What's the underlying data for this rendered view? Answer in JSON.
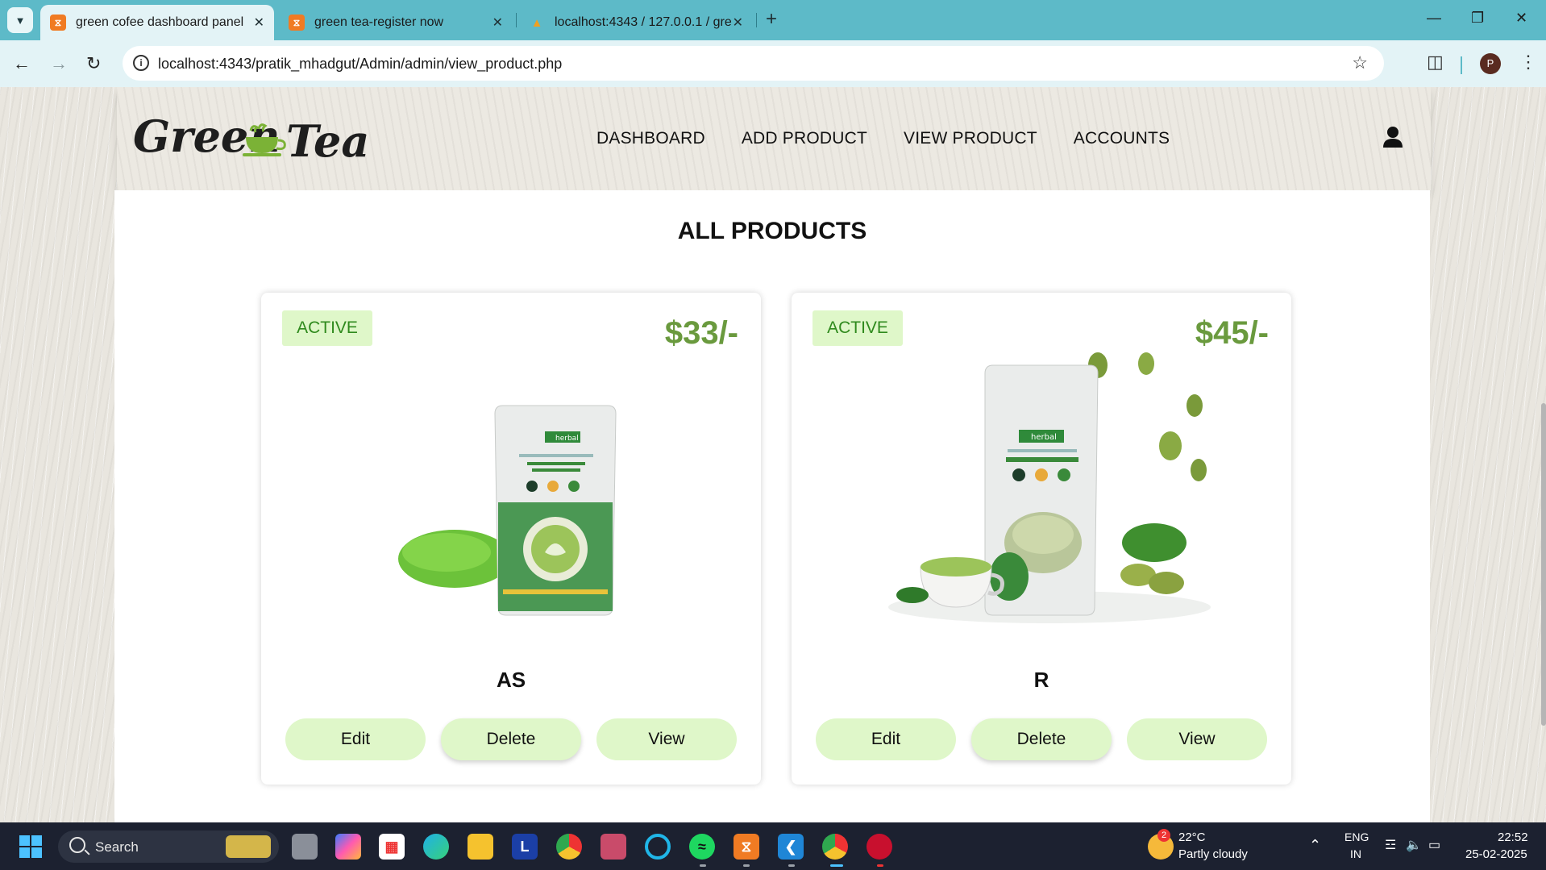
{
  "browser": {
    "tabs": [
      {
        "title": "green cofee dashboard panel",
        "active": true,
        "icon": "xampp-icon"
      },
      {
        "title": "green tea-register now",
        "active": false,
        "icon": "xampp-icon"
      },
      {
        "title": "localhost:4343 / 127.0.0.1 / gre",
        "active": false,
        "icon": "phpmyadmin-icon"
      }
    ],
    "url": "localhost:4343/pratik_mhadgut/Admin/admin/view_product.php",
    "profile_initial": "P"
  },
  "site": {
    "nav": [
      "DASHBOARD",
      "ADD PRODUCT",
      "VIEW PRODUCT",
      "ACCOUNTS"
    ]
  },
  "page": {
    "heading": "ALL PRODUCTS",
    "products": [
      {
        "status": "ACTIVE",
        "price": "$33/-",
        "name": "AS",
        "buttons": [
          "Edit",
          "Delete",
          "View"
        ]
      },
      {
        "status": "ACTIVE",
        "price": "$45/-",
        "name": "R",
        "buttons": [
          "Edit",
          "Delete",
          "View"
        ]
      }
    ]
  },
  "taskbar": {
    "search_label": "Search",
    "weather": {
      "temp": "22°C",
      "desc": "Partly cloudy",
      "badge": "2"
    },
    "lang": {
      "line1": "ENG",
      "line2": "IN"
    },
    "time": "22:52",
    "date": "25-02-2025"
  },
  "colors": {
    "tabbar": "#5dbac8",
    "badge_bg": "#dff7c9",
    "badge_text": "#2f8a1d",
    "price": "#6a9a3e"
  }
}
